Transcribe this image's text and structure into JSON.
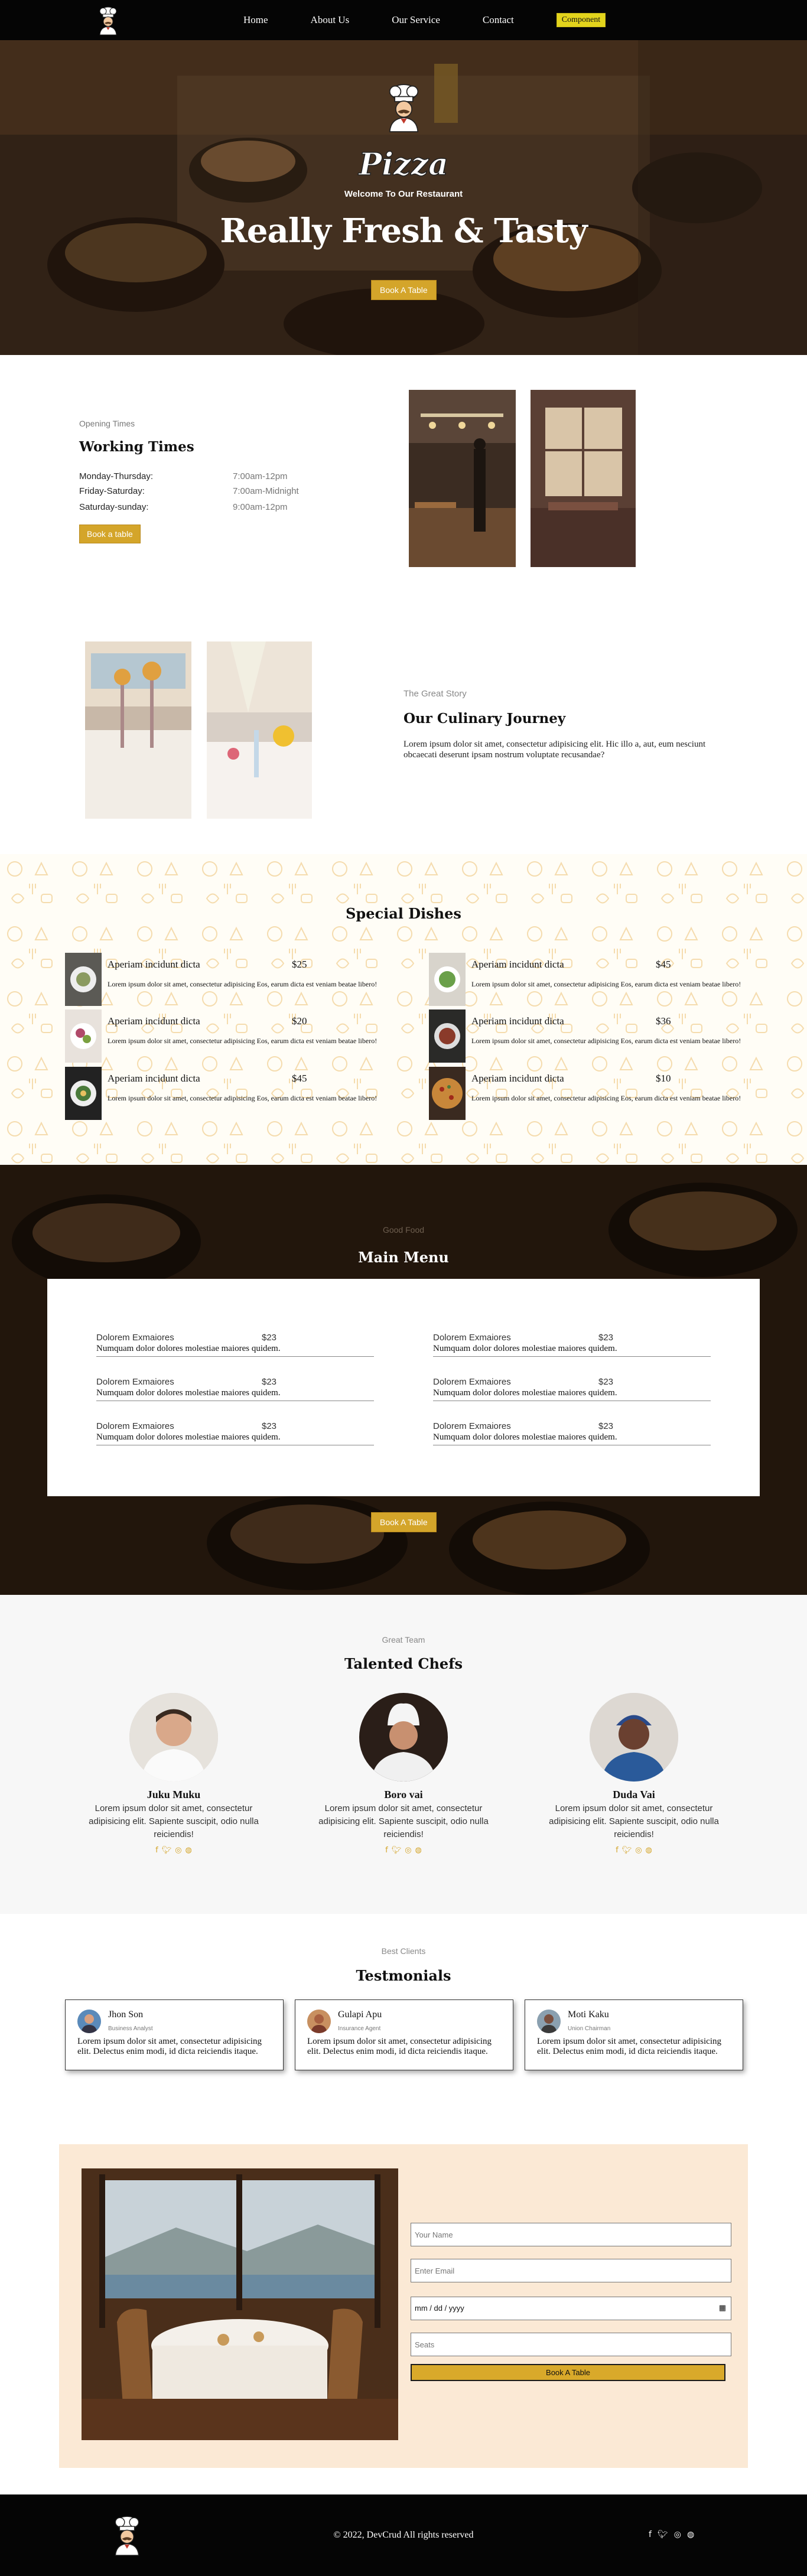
{
  "nav": {
    "links": [
      "Home",
      "About Us",
      "Our Service",
      "Contact"
    ],
    "cta": "Component"
  },
  "hero": {
    "brand": "Pizza",
    "welcome": "Welcome To Our Restaurant",
    "title": "Really Fresh & Tasty",
    "button": "Book A Table"
  },
  "hours": {
    "eyebrow": "Opening Times",
    "title": "Working Times",
    "rows": [
      {
        "day": "Monday-Thursday:",
        "time": "7:00am-12pm"
      },
      {
        "day": "Friday-Saturday:",
        "time": "7:00am-Midnight"
      },
      {
        "day": "Saturday-sunday:",
        "time": "9:00am-12pm"
      }
    ],
    "button": "Book a table"
  },
  "story": {
    "eyebrow": "The Great Story",
    "title": "Our Culinary Journey",
    "text": "Lorem ipsum dolor sit amet, consectetur adipisicing elit. Hic illo a, aut, eum nesciunt obcaecati deserunt ipsam nostrum voluptate recusandae?"
  },
  "dishes": {
    "title": "Special Dishes",
    "items": [
      {
        "name": "Aperiam incidunt dicta",
        "price": "$25",
        "desc": "Lorem ipsum dolor sit amet, consectetur adipisicing Eos, earum dicta est veniam beatae libero!"
      },
      {
        "name": "Aperiam incidunt dicta",
        "price": "$45",
        "desc": "Lorem ipsum dolor sit amet, consectetur adipisicing Eos, earum dicta est veniam beatae libero!"
      },
      {
        "name": "Aperiam incidunt dicta",
        "price": "$20",
        "desc": "Lorem ipsum dolor sit amet, consectetur adipisicing Eos, earum dicta est veniam beatae libero!"
      },
      {
        "name": "Aperiam incidunt dicta",
        "price": "$36",
        "desc": "Lorem ipsum dolor sit amet, consectetur adipisicing Eos, earum dicta est veniam beatae libero!"
      },
      {
        "name": "Aperiam incidunt dicta",
        "price": "$45",
        "desc": "Lorem ipsum dolor sit amet, consectetur adipisicing Eos, earum dicta est veniam beatae libero!"
      },
      {
        "name": "Aperiam incidunt dicta",
        "price": "$10",
        "desc": "Lorem ipsum dolor sit amet, consectetur adipisicing Eos, earum dicta est veniam beatae libero!"
      }
    ]
  },
  "mainmenu": {
    "eyebrow": "Good Food",
    "title": "Main Menu",
    "items": [
      {
        "name": "Dolorem Exmaiores",
        "price": "$23",
        "desc": "Numquam dolor dolores molestiae maiores quidem."
      },
      {
        "name": "Dolorem Exmaiores",
        "price": "$23",
        "desc": "Numquam dolor dolores molestiae maiores quidem."
      },
      {
        "name": "Dolorem Exmaiores",
        "price": "$23",
        "desc": "Numquam dolor dolores molestiae maiores quidem."
      },
      {
        "name": "Dolorem Exmaiores",
        "price": "$23",
        "desc": "Numquam dolor dolores molestiae maiores quidem."
      },
      {
        "name": "Dolorem Exmaiores",
        "price": "$23",
        "desc": "Numquam dolor dolores molestiae maiores quidem."
      },
      {
        "name": "Dolorem Exmaiores",
        "price": "$23",
        "desc": "Numquam dolor dolores molestiae maiores quidem."
      }
    ],
    "button": "Book A Table"
  },
  "chefs": {
    "eyebrow": "Great Team",
    "title": "Talented Chefs",
    "items": [
      {
        "name": "Juku Muku",
        "bio": "Lorem ipsum dolor sit amet, consectetur adipisicing elit. Sapiente suscipit, odio nulla reiciendis!"
      },
      {
        "name": "Boro vai",
        "bio": "Lorem ipsum dolor sit amet, consectetur adipisicing elit. Sapiente suscipit, odio nulla reiciendis!"
      },
      {
        "name": "Duda Vai",
        "bio": "Lorem ipsum dolor sit amet, consectetur adipisicing elit. Sapiente suscipit, odio nulla reiciendis!"
      }
    ],
    "social_icons": [
      "facebook-icon",
      "twitter-icon",
      "instagram-icon",
      "dribbble-icon"
    ]
  },
  "testimonials": {
    "eyebrow": "Best Clients",
    "title": "Testmonials",
    "items": [
      {
        "name": "Jhon Son",
        "role": "Business Analyst",
        "text": "Lorem ipsum dolor sit amet, consectetur adipisicing elit. Delectus enim modi, id dicta reiciendis itaque."
      },
      {
        "name": "Gulapi Apu",
        "role": "Insurance Agent",
        "text": "Lorem ipsum dolor sit amet, consectetur adipisicing elit. Delectus enim modi, id dicta reiciendis itaque."
      },
      {
        "name": "Moti Kaku",
        "role": "Union Chairman",
        "text": "Lorem ipsum dolor sit amet, consectetur adipisicing elit. Delectus enim modi, id dicta reiciendis itaque."
      }
    ]
  },
  "booking": {
    "name_placeholder": "Your Name",
    "email_placeholder": "Enter Email",
    "date_placeholder": "mm / dd / yyyy",
    "seats_placeholder": "Seats",
    "submit": "Book A Table"
  },
  "footer": {
    "copyright": "© 2022, DevCrud All rights reserved"
  },
  "colors": {
    "accent": "#d4a52a",
    "nav_cta": "#e3d41c",
    "booking_bg": "#fbe9d5",
    "nav_bg": "#050505"
  }
}
